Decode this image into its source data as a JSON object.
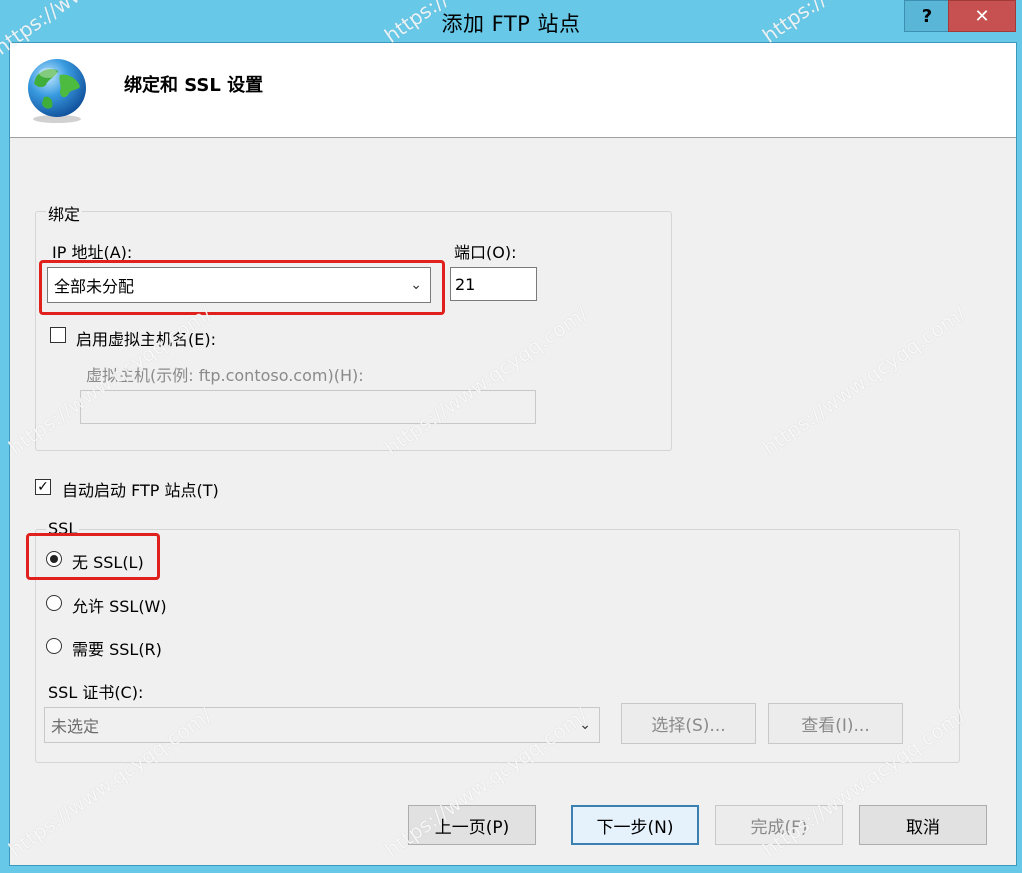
{
  "window": {
    "title": "添加 FTP 站点",
    "help_glyph": "?",
    "close_glyph": "✕"
  },
  "header": {
    "title": "绑定和 SSL 设置",
    "icon": "globe-icon"
  },
  "binding": {
    "group_label": "绑定",
    "ip_label": "IP 地址(A):",
    "ip_value": "全部未分配",
    "port_label": "端口(O):",
    "port_value": "21",
    "enable_vhost_label": "启用虚拟主机名(E):",
    "enable_vhost_checked": false,
    "vhost_label": "虚拟主机(示例: ftp.contoso.com)(H):",
    "vhost_value": ""
  },
  "auto_start": {
    "label": "自动启动 FTP 站点(T)",
    "checked": true
  },
  "ssl": {
    "group_label": "SSL",
    "options": [
      {
        "label": "无 SSL(L)",
        "selected": true
      },
      {
        "label": "允许 SSL(W)",
        "selected": false
      },
      {
        "label": "需要 SSL(R)",
        "selected": false
      }
    ],
    "cert_label": "SSL 证书(C):",
    "cert_value": "未选定",
    "select_button": "选择(S)...",
    "view_button": "查看(I)..."
  },
  "footer": {
    "prev_button": "上一页(P)",
    "next_button": "下一步(N)",
    "finish_button": "完成(F)",
    "cancel_button": "取消"
  },
  "watermark": "https://www.qcyqq.com/",
  "colors": {
    "titlebar": "#67c8e8",
    "highlight": "#e0201c",
    "close_button": "#c75050"
  }
}
